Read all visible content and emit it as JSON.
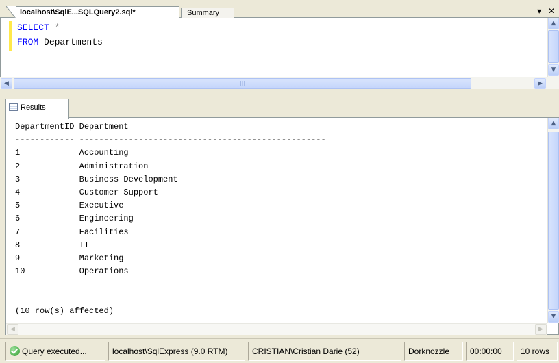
{
  "document_tabs": {
    "active": "localhost\\SqlE...SQLQuery2.sql*",
    "inactive": "Summary",
    "dropdown_glyph": "▾",
    "close_glyph": "✕"
  },
  "editor": {
    "line1_keyword": "SELECT",
    "line1_rest": " *",
    "line2_keyword": "FROM",
    "line2_rest": " Departments"
  },
  "results": {
    "tab_label": "Results",
    "header_line": "DepartmentID Department",
    "divider_line": "------------ --------------------------------------------------",
    "rows": [
      [
        "1",
        "Accounting"
      ],
      [
        "2",
        "Administration"
      ],
      [
        "3",
        "Business Development"
      ],
      [
        "4",
        "Customer Support"
      ],
      [
        "5",
        "Executive"
      ],
      [
        "6",
        "Engineering"
      ],
      [
        "7",
        "Facilities"
      ],
      [
        "8",
        "IT"
      ],
      [
        "9",
        "Marketing"
      ],
      [
        "10",
        "Operations"
      ]
    ],
    "affected": "(10 row(s) affected)"
  },
  "statusbar": {
    "query_status": "Query executed...",
    "server": "localhost\\SqlExpress (9.0 RTM)",
    "user": "CRISTIAN\\Cristian Darie (52)",
    "database": "Dorknozzle",
    "elapsed": "00:00:00",
    "row_count": "10 rows"
  },
  "icons": {
    "status_icon": "check-circle-icon",
    "results_tab_icon": "grid-icon"
  },
  "colors": {
    "keyword": "#0000ff",
    "margin_changed": "#ffe84a",
    "status_ok": "#2c9b2c"
  }
}
